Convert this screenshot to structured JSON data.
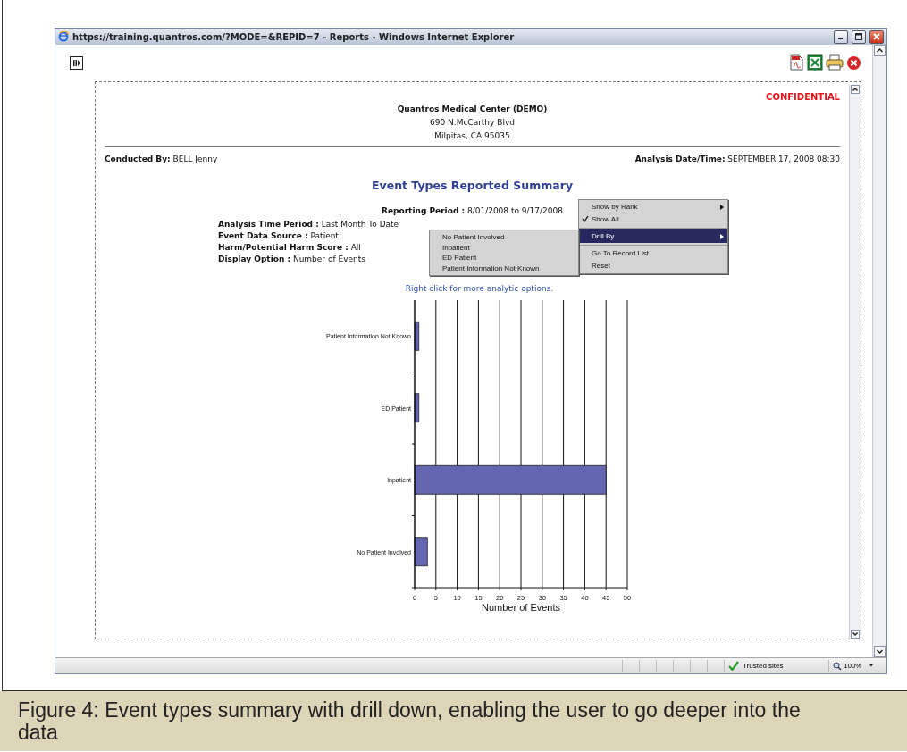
{
  "window": {
    "title": "https://training.quantros.com/?MODE=&REPID=7 - Reports - Windows Internet Explorer"
  },
  "report": {
    "confidential": "CONFIDENTIAL",
    "organization": [
      "Quantros Medical Center (DEMO)",
      "690 N.McCarthy Blvd",
      "Milpitas, CA 95035"
    ],
    "conducted_by": {
      "label": "Conducted By:",
      "value": "BELL Jenny"
    },
    "analysis_datetime": {
      "label": "Analysis Date/Time:",
      "value": "SEPTEMBER 17, 2008 08:30"
    },
    "title": "Event Types Reported Summary",
    "reporting_period": {
      "label": "Reporting Period :",
      "value": "8/01/2008 to 9/17/2008"
    },
    "parameters": [
      {
        "label": "Analysis Time Period :",
        "value": "Last Month To Date"
      },
      {
        "label": "Event Data Source :",
        "value": "Patient"
      },
      {
        "label": "Harm/Potential Harm Score :",
        "value": "All"
      },
      {
        "label": "Display Option :",
        "value": "Number of Events"
      }
    ],
    "hint": "Right click for more analytic options.",
    "chart_data": {
      "type": "bar",
      "orientation": "horizontal",
      "xlabel": "Number of Events",
      "categories": [
        "Patient Information Not Known",
        "ED Patient",
        "Inpatient",
        "No Patient Involved"
      ],
      "values": [
        1,
        1,
        45,
        3
      ],
      "grid": true,
      "xlim": [
        0,
        50
      ],
      "xticks": [
        0,
        5,
        10,
        15,
        20,
        25,
        30,
        35,
        40,
        45,
        50
      ]
    }
  },
  "context_menu": {
    "items": [
      {
        "label": "Show by Rank",
        "checked": false,
        "selected": false,
        "has_submenu": true,
        "divider_before": false
      },
      {
        "label": "Show All",
        "checked": true,
        "selected": false,
        "has_submenu": false,
        "divider_before": false
      },
      {
        "label": "Drill By",
        "checked": false,
        "selected": true,
        "has_submenu": true,
        "divider_before": true
      },
      {
        "label": "Go To Record List",
        "checked": false,
        "selected": false,
        "has_submenu": false,
        "divider_before": true
      },
      {
        "label": "Reset",
        "checked": false,
        "selected": false,
        "has_submenu": false,
        "divider_before": false
      }
    ],
    "submenu": [
      "No Patient Involved",
      "Inpatient",
      "ED Patient",
      "Patient Information Not Known"
    ]
  },
  "status_bar": {
    "zone": "Trusted sites",
    "zoom": "100%"
  },
  "caption": "Figure 4:  Event types summary with drill down, enabling the user to go deeper into the data"
}
